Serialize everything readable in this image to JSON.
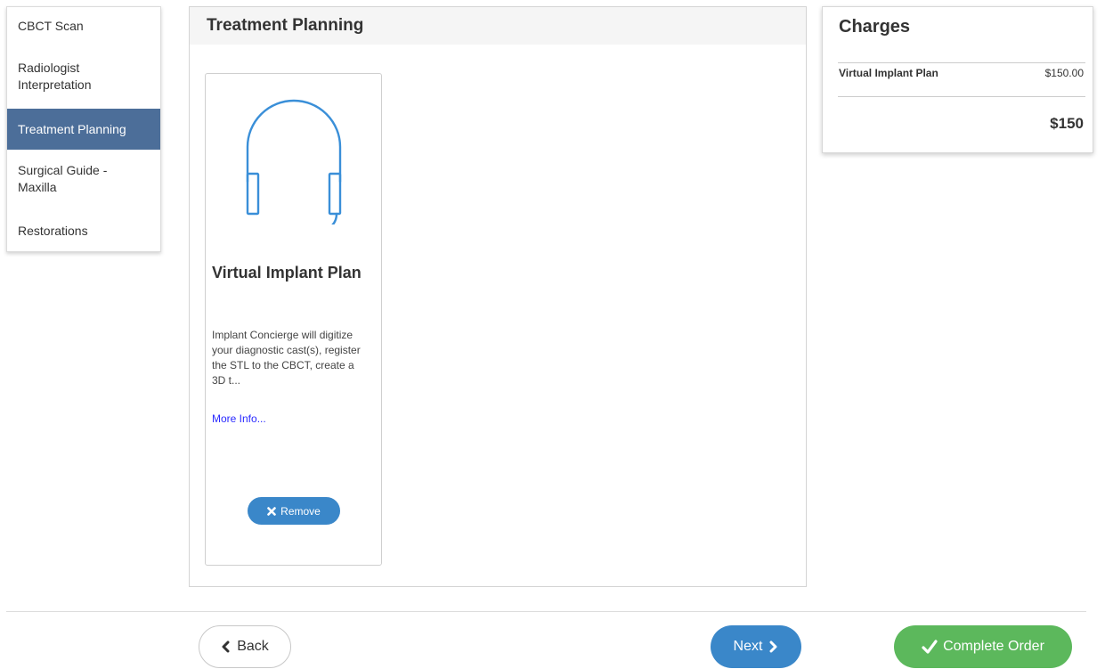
{
  "sidebar": {
    "items": [
      {
        "label": "CBCT Scan",
        "active": false
      },
      {
        "label": "Radiologist Interpretation",
        "active": false
      },
      {
        "label": "Treatment Planning",
        "active": true
      },
      {
        "label": "Surgical Guide - Maxilla",
        "active": false
      },
      {
        "label": "Restorations",
        "active": false
      }
    ]
  },
  "main": {
    "title": "Treatment Planning",
    "card": {
      "icon": "headset-icon",
      "title": "Virtual Implant Plan",
      "description": "Implant Concierge will digitize your diagnostic cast(s), register the STL to the CBCT, create a 3D t...",
      "more_link": "More Info...",
      "remove_label": "Remove"
    }
  },
  "charges": {
    "title": "Charges",
    "items": [
      {
        "label": "Virtual Implant Plan",
        "amount": "$150.00"
      }
    ],
    "total": "$150"
  },
  "footer": {
    "back_label": "Back",
    "next_label": "Next",
    "complete_label": "Complete Order"
  },
  "colors": {
    "accent_blue": "#3a87c9",
    "sidebar_active": "#4c6e99",
    "success_green": "#5cb85c",
    "link_blue": "#2a2aff"
  }
}
